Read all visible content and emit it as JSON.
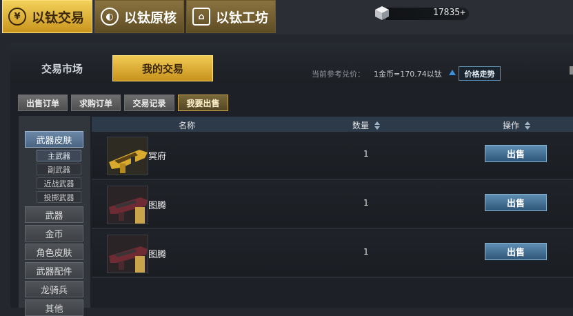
{
  "top_tabs": [
    {
      "label": "以钛交易",
      "icon": "coin-icon",
      "active": true
    },
    {
      "label": "以钛原核",
      "icon": "core-icon",
      "active": false
    },
    {
      "label": "以钛工坊",
      "icon": "house-icon",
      "active": false
    }
  ],
  "balance": {
    "value": "17835+",
    "icon": "titanium-cube-icon"
  },
  "sub_tabs": [
    {
      "label": "交易市场",
      "active": false
    },
    {
      "label": "我的交易",
      "active": true
    }
  ],
  "exchange": {
    "label": "当前参考兑价：",
    "value": "1金币=170.74以钛",
    "trend_button": "价格走势",
    "trend_icon": "trend-up-icon"
  },
  "filters": [
    {
      "label": "出售订单",
      "active": false
    },
    {
      "label": "求购订单",
      "active": false
    },
    {
      "label": "交易记录",
      "active": false
    },
    {
      "label": "我要出售",
      "active": true
    }
  ],
  "sidebar": {
    "weapon_skin": "武器皮肤",
    "sub_items": [
      "主武器",
      "副武器",
      "近战武器",
      "投掷武器"
    ],
    "items": [
      "武器",
      "金币",
      "角色皮肤",
      "武器配件",
      "龙骑兵",
      "其他"
    ]
  },
  "table": {
    "columns": [
      "名称",
      "数量",
      "操作"
    ],
    "rows": [
      {
        "name": "冥府",
        "quantity": "1",
        "action": "出售"
      },
      {
        "name": "图腾",
        "quantity": "1",
        "action": "出售"
      },
      {
        "name": "图腾",
        "quantity": "1",
        "action": "出售"
      }
    ]
  }
}
